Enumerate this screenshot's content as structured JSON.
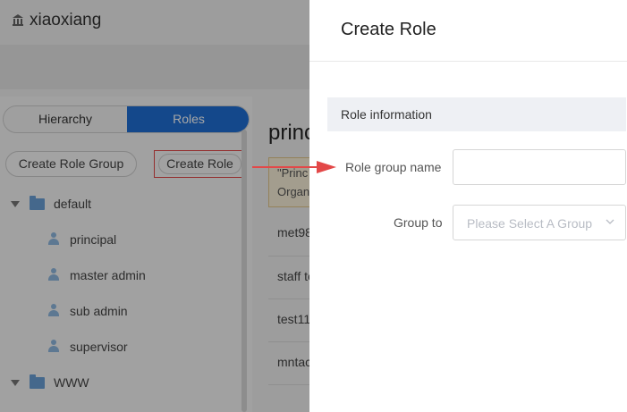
{
  "header": {
    "org_name": "xiaoxiang",
    "org_icon": "building-icon"
  },
  "left_panel": {
    "tabs": [
      {
        "label": "Hierarchy",
        "active": false
      },
      {
        "label": "Roles",
        "active": true
      }
    ],
    "create_role_group_label": "Create Role Group",
    "create_role_label": "Create Role",
    "tree": [
      {
        "type": "group",
        "label": "default"
      },
      {
        "type": "role",
        "label": "principal"
      },
      {
        "type": "role",
        "label": "master admin"
      },
      {
        "type": "role",
        "label": "sub admin"
      },
      {
        "type": "role",
        "label": "supervisor"
      },
      {
        "type": "group",
        "label": "WWW"
      }
    ]
  },
  "right_panel": {
    "title": "princ",
    "note_lines": [
      "\"Princ",
      "Organ"
    ],
    "rows": [
      "met98",
      "staff te",
      "test11",
      "mntac"
    ]
  },
  "drawer": {
    "title": "Create Role",
    "section_label": "Role information",
    "fields": {
      "role_group_name_label": "Role group name",
      "role_group_name_value": "",
      "group_to_label": "Group to",
      "group_to_placeholder": "Please Select A Group"
    }
  },
  "colors": {
    "accent": "#1f6fd6",
    "highlight": "#e34848"
  }
}
